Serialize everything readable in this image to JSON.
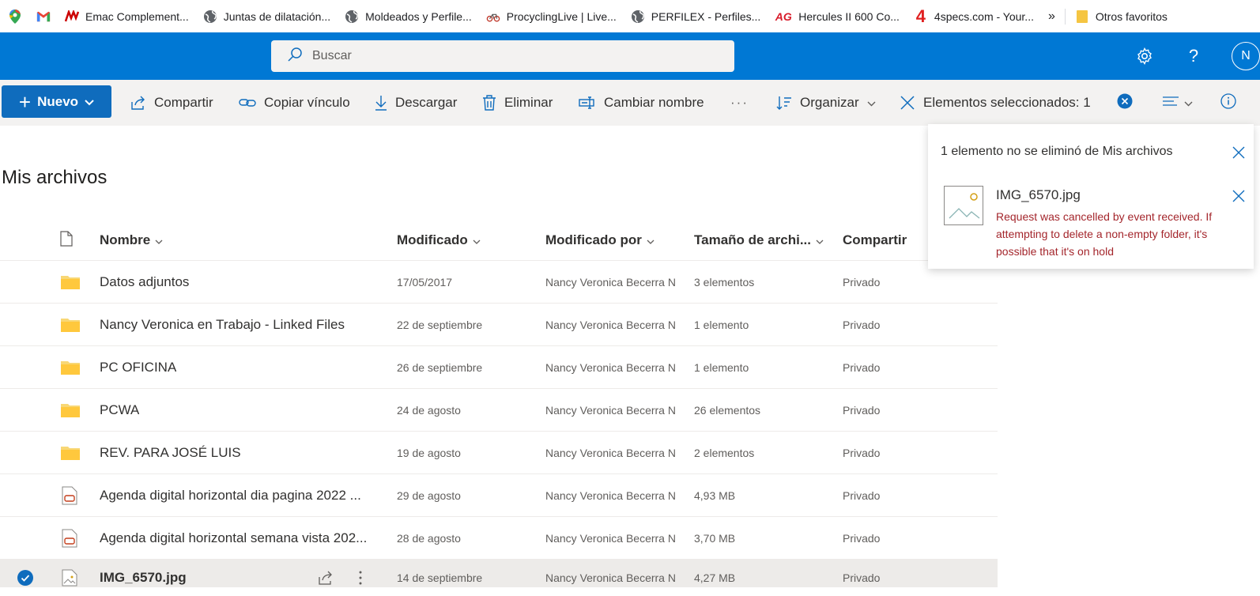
{
  "bookmarks": [
    {
      "icon": "maps-pin-icon",
      "label": ""
    },
    {
      "icon": "gmail-icon",
      "label": ""
    },
    {
      "icon": "emac-logo-icon",
      "label": "Emac Complement..."
    },
    {
      "icon": "globe-icon",
      "label": "Juntas de dilatación..."
    },
    {
      "icon": "globe-icon",
      "label": "Moldeados y Perfile..."
    },
    {
      "icon": "procycling-icon",
      "label": "ProcyclingLive | Live..."
    },
    {
      "icon": "globe-icon",
      "label": "PERFILEX - Perfiles..."
    },
    {
      "icon": "ag-logo-icon",
      "label": "Hercules II 600 Co..."
    },
    {
      "icon": "4specs-icon",
      "label": "4specs.com - Your..."
    }
  ],
  "bookmarks_more": "»",
  "other_favorites": "Otros favoritos",
  "header": {
    "search_placeholder": "Buscar",
    "avatar_initial": "N",
    "accent": "#0078d4"
  },
  "commands": {
    "new_label": "Nuevo",
    "share": "Compartir",
    "copy_link": "Copiar vínculo",
    "download": "Descargar",
    "delete": "Eliminar",
    "rename": "Cambiar nombre",
    "more": "···",
    "sort": "Organizar",
    "selected": "Elementos seleccionados: 1"
  },
  "page_title": "Mis archivos",
  "columns": {
    "name": "Nombre",
    "modified": "Modificado",
    "modified_by": "Modificado por",
    "size": "Tamaño de archi...",
    "sharing": "Compartir"
  },
  "rows": [
    {
      "type": "folder",
      "name": "Datos adjuntos",
      "modified": "17/05/2017",
      "by": "Nancy Veronica Becerra N",
      "size": "3 elementos",
      "sharing": "Privado"
    },
    {
      "type": "folder",
      "name": "Nancy Veronica en Trabajo - Linked Files",
      "modified": "22 de septiembre",
      "by": "Nancy Veronica Becerra N",
      "size": "1 elemento",
      "sharing": "Privado"
    },
    {
      "type": "folder",
      "name": "PC OFICINA",
      "modified": "26 de septiembre",
      "by": "Nancy Veronica Becerra N",
      "size": "1 elemento",
      "sharing": "Privado"
    },
    {
      "type": "folder",
      "name": "PCWA",
      "modified": "24 de agosto",
      "by": "Nancy Veronica Becerra N",
      "size": "26 elementos",
      "sharing": "Privado"
    },
    {
      "type": "folder",
      "name": "REV. PARA JOSÉ LUIS",
      "modified": "19 de agosto",
      "by": "Nancy Veronica Becerra N",
      "size": "2 elementos",
      "sharing": "Privado"
    },
    {
      "type": "pdf",
      "name": "Agenda digital horizontal dia pagina  2022 ...",
      "modified": "29 de agosto",
      "by": "Nancy Veronica Becerra N",
      "size": "4,93 MB",
      "sharing": "Privado"
    },
    {
      "type": "pdf",
      "name": "Agenda digital horizontal semana vista  202...",
      "modified": "28 de agosto",
      "by": "Nancy Veronica Becerra N",
      "size": "3,70 MB",
      "sharing": "Privado"
    },
    {
      "type": "image",
      "name": "IMG_6570.jpg",
      "modified": "14 de septiembre",
      "by": "Nancy Veronica Becerra N",
      "size": "4,27 MB",
      "sharing": "Privado",
      "selected": true
    }
  ],
  "notification": {
    "title": "1 elemento no se eliminó de Mis archivos",
    "file": "IMG_6570.jpg",
    "error": "Request was cancelled by event received. If attempting to delete a non-empty folder, it's possible that it's on hold",
    "error_color": "#a4262c"
  }
}
